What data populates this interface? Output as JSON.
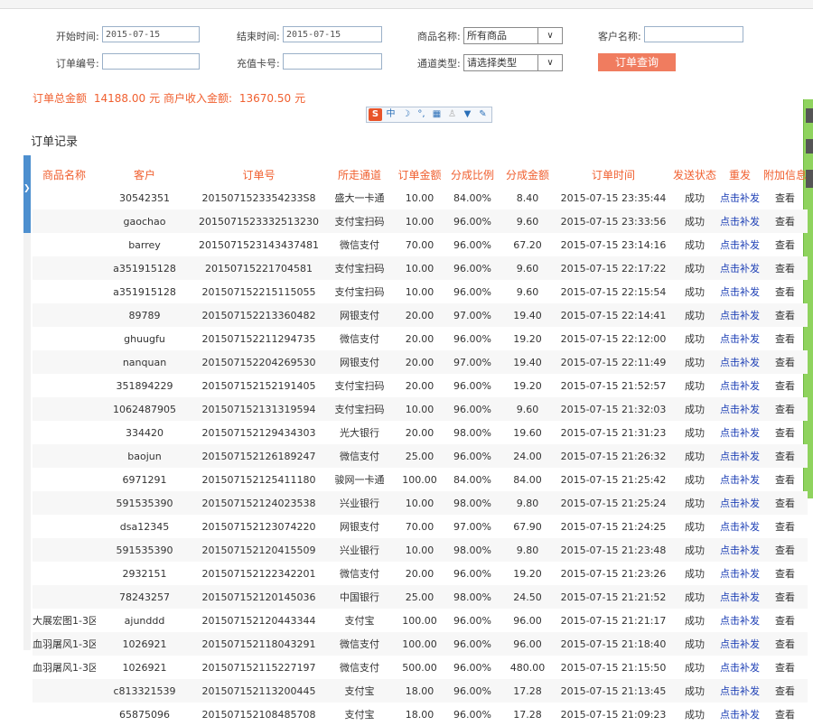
{
  "filters": {
    "start_time": {
      "label": "开始时间:",
      "value": "2015-07-15"
    },
    "end_time": {
      "label": "结束时间:",
      "value": "2015-07-15"
    },
    "product": {
      "label": "商品名称:",
      "value": "所有商品"
    },
    "customer": {
      "label": "客户名称:",
      "value": ""
    },
    "order_no": {
      "label": "订单编号:",
      "value": ""
    },
    "card_no": {
      "label": "充值卡号:",
      "value": ""
    },
    "channel": {
      "label": "通道类型:",
      "value": "请选择类型"
    },
    "query_button": "订单查询"
  },
  "summary": {
    "total_label": "订单总金额",
    "total_value": "14188.00",
    "unit1": "元",
    "income_label": "商户收入金额:",
    "income_value": "13670.50",
    "unit2": "元"
  },
  "toolbar_icons": [
    "s-logo-icon",
    "zhong-icon",
    "moon-icon",
    "comma-icon",
    "keyboard-icon",
    "person-icon",
    "shirt-icon",
    "wrench-icon"
  ],
  "section_title": "订单记录",
  "table": {
    "headers": [
      "商品名称",
      "客户",
      "订单号",
      "所走通道",
      "订单金额",
      "分成比例",
      "分成金额",
      "订单时间",
      "发送状态",
      "重发",
      "附加信息"
    ],
    "rows": [
      [
        "",
        "30542351",
        "2015071523354233S8",
        "盛大一卡通",
        "10.00",
        "84.00%",
        "8.40",
        "2015-07-15 23:35:44",
        "成功",
        "点击补发",
        "查看"
      ],
      [
        "",
        "gaochao",
        "2015071523332513230",
        "支付宝扫码",
        "10.00",
        "96.00%",
        "9.60",
        "2015-07-15 23:33:56",
        "成功",
        "点击补发",
        "查看"
      ],
      [
        "",
        "barrey",
        "2015071523143437481",
        "微信支付",
        "70.00",
        "96.00%",
        "67.20",
        "2015-07-15 23:14:16",
        "成功",
        "点击补发",
        "查看"
      ],
      [
        "",
        "a351915128",
        "20150715221704581",
        "支付宝扫码",
        "10.00",
        "96.00%",
        "9.60",
        "2015-07-15 22:17:22",
        "成功",
        "点击补发",
        "查看"
      ],
      [
        "",
        "a351915128",
        "201507152215115055",
        "支付宝扫码",
        "10.00",
        "96.00%",
        "9.60",
        "2015-07-15 22:15:54",
        "成功",
        "点击补发",
        "查看"
      ],
      [
        "",
        "89789",
        "201507152213360482",
        "网银支付",
        "20.00",
        "97.00%",
        "19.40",
        "2015-07-15 22:14:41",
        "成功",
        "点击补发",
        "查看"
      ],
      [
        "",
        "ghuugfu",
        "201507152211294735",
        "微信支付",
        "20.00",
        "96.00%",
        "19.20",
        "2015-07-15 22:12:00",
        "成功",
        "点击补发",
        "查看"
      ],
      [
        "",
        "nanquan",
        "201507152204269530",
        "网银支付",
        "20.00",
        "97.00%",
        "19.40",
        "2015-07-15 22:11:49",
        "成功",
        "点击补发",
        "查看"
      ],
      [
        "",
        "351894229",
        "201507152152191405",
        "支付宝扫码",
        "20.00",
        "96.00%",
        "19.20",
        "2015-07-15 21:52:57",
        "成功",
        "点击补发",
        "查看"
      ],
      [
        "",
        "1062487905",
        "201507152131319594",
        "支付宝扫码",
        "10.00",
        "96.00%",
        "9.60",
        "2015-07-15 21:32:03",
        "成功",
        "点击补发",
        "查看"
      ],
      [
        "",
        "334420",
        "201507152129434303",
        "光大银行",
        "20.00",
        "98.00%",
        "19.60",
        "2015-07-15 21:31:23",
        "成功",
        "点击补发",
        "查看"
      ],
      [
        "",
        "baojun",
        "201507152126189247",
        "微信支付",
        "25.00",
        "96.00%",
        "24.00",
        "2015-07-15 21:26:32",
        "成功",
        "点击补发",
        "查看"
      ],
      [
        "",
        "6971291",
        "201507152125411180",
        "骏网一卡通",
        "100.00",
        "84.00%",
        "84.00",
        "2015-07-15 21:25:42",
        "成功",
        "点击补发",
        "查看"
      ],
      [
        "",
        "591535390",
        "201507152124023538",
        "兴业银行",
        "10.00",
        "98.00%",
        "9.80",
        "2015-07-15 21:25:24",
        "成功",
        "点击补发",
        "查看"
      ],
      [
        "",
        "dsa12345",
        "201507152123074220",
        "网银支付",
        "70.00",
        "97.00%",
        "67.90",
        "2015-07-15 21:24:25",
        "成功",
        "点击补发",
        "查看"
      ],
      [
        "",
        "591535390",
        "201507152120415509",
        "兴业银行",
        "10.00",
        "98.00%",
        "9.80",
        "2015-07-15 21:23:48",
        "成功",
        "点击补发",
        "查看"
      ],
      [
        "",
        "2932151",
        "201507152122342201",
        "微信支付",
        "20.00",
        "96.00%",
        "19.20",
        "2015-07-15 21:23:26",
        "成功",
        "点击补发",
        "查看"
      ],
      [
        "",
        "78243257",
        "201507152120145036",
        "中国银行",
        "25.00",
        "98.00%",
        "24.50",
        "2015-07-15 21:21:52",
        "成功",
        "点击补发",
        "查看"
      ],
      [
        "大展宏图1-3区",
        "ajunddd",
        "201507152120443344",
        "支付宝",
        "100.00",
        "96.00%",
        "96.00",
        "2015-07-15 21:21:17",
        "成功",
        "点击补发",
        "查看"
      ],
      [
        "血羽屠风1-3区",
        "1026921",
        "201507152118043291",
        "微信支付",
        "100.00",
        "96.00%",
        "96.00",
        "2015-07-15 21:18:40",
        "成功",
        "点击补发",
        "查看"
      ],
      [
        "血羽屠风1-3区",
        "1026921",
        "201507152115227197",
        "微信支付",
        "500.00",
        "96.00%",
        "480.00",
        "2015-07-15 21:15:50",
        "成功",
        "点击补发",
        "查看"
      ],
      [
        "",
        "c813321539",
        "201507152113200445",
        "支付宝",
        "18.00",
        "96.00%",
        "17.28",
        "2015-07-15 21:13:45",
        "成功",
        "点击补发",
        "查看"
      ],
      [
        "",
        "65875096",
        "201507152108485708",
        "支付宝",
        "18.00",
        "96.00%",
        "17.28",
        "2015-07-15 21:09:23",
        "成功",
        "点击补发",
        "查看"
      ]
    ]
  },
  "colors": {
    "accent": "#f05f2f",
    "button": "#f07c5f",
    "success": "#2e8b2e",
    "link": "#1d3fb5",
    "left_tab": "#4d8fcf",
    "right_tab": "#8fd35e"
  }
}
